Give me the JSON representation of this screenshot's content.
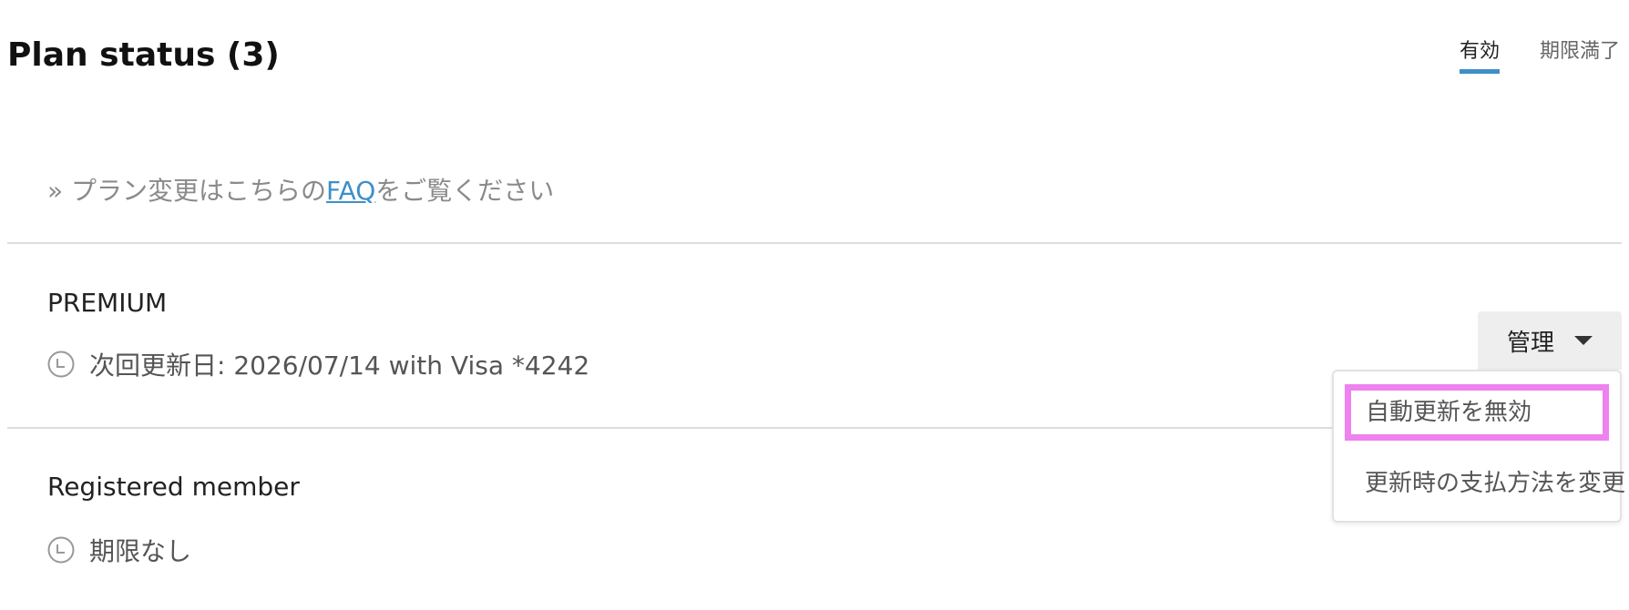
{
  "header": {
    "title": "Plan status (3)",
    "tabs": [
      {
        "label": "有効",
        "active": true
      },
      {
        "label": "期限満了",
        "active": false
      }
    ]
  },
  "faq": {
    "prefix": "» プラン変更はこちらの",
    "link": "FAQ",
    "suffix": "をご覧ください"
  },
  "plans": [
    {
      "name": "PREMIUM",
      "meta": "次回更新日: 2026/07/14 with Visa *4242",
      "icon": "clock-icon"
    },
    {
      "name": "Registered member",
      "meta": "期限なし",
      "icon": "clock-icon"
    }
  ],
  "manage": {
    "label": "管理",
    "menu": [
      {
        "label": "自動更新を無効",
        "highlighted": true
      },
      {
        "label": "更新時の支払方法を変更",
        "highlighted": false
      }
    ]
  },
  "colors": {
    "accent": "#3d8fc9",
    "highlight": "#ee82ee"
  }
}
